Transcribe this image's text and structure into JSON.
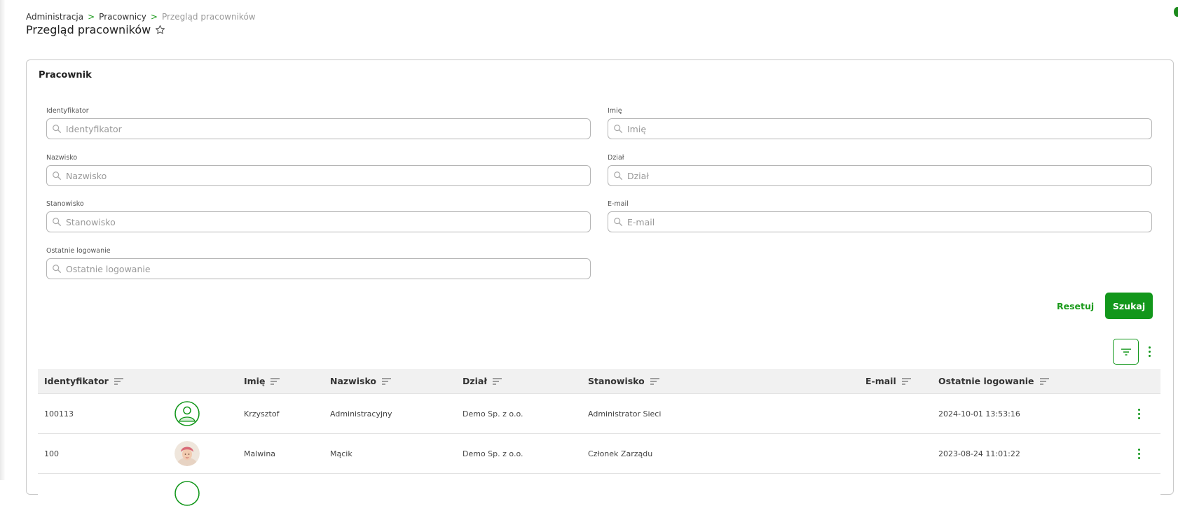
{
  "breadcrumb": {
    "items": [
      "Administracja",
      "Pracownicy"
    ],
    "separator": ">",
    "current": "Przegląd pracowników"
  },
  "page_title": "Przegląd pracowników",
  "panel": {
    "title": "Pracownik",
    "fields": {
      "identyfikator": {
        "label": "Identyfikator",
        "placeholder": "Identyfikator",
        "value": ""
      },
      "imie": {
        "label": "Imię",
        "placeholder": "Imię",
        "value": ""
      },
      "nazwisko": {
        "label": "Nazwisko",
        "placeholder": "Nazwisko",
        "value": ""
      },
      "dzial": {
        "label": "Dział",
        "placeholder": "Dział",
        "value": ""
      },
      "stanowisko": {
        "label": "Stanowisko",
        "placeholder": "Stanowisko",
        "value": ""
      },
      "email": {
        "label": "E-mail",
        "placeholder": "E-mail",
        "value": ""
      },
      "ostatnie_logowanie": {
        "label": "Ostatnie logowanie",
        "placeholder": "Ostatnie logowanie",
        "value": ""
      }
    },
    "reset_label": "Resetuj",
    "search_label": "Szukaj"
  },
  "table": {
    "columns": [
      "Identyfikator",
      "Imię",
      "Nazwisko",
      "Dział",
      "Stanowisko",
      "E-mail",
      "Ostatnie logowanie"
    ],
    "rows": [
      {
        "id": "100113",
        "avatar": "default-user-icon",
        "first_name": "Krzysztof",
        "last_name": "Administracyjny",
        "department": "Demo Sp. z o.o.",
        "position": "Administrator Sieci",
        "email": "",
        "last_login": "2024-10-01 13:53:16"
      },
      {
        "id": "100",
        "avatar": "photo",
        "first_name": "Malwina",
        "last_name": "Mącik",
        "department": "Demo Sp. z o.o.",
        "position": "Członek Zarządu",
        "email": "",
        "last_login": "2023-08-24 11:01:22"
      }
    ]
  },
  "colors": {
    "accent": "#12971b",
    "header_bg": "#f1f1f1",
    "border": "#c9c9c9"
  }
}
